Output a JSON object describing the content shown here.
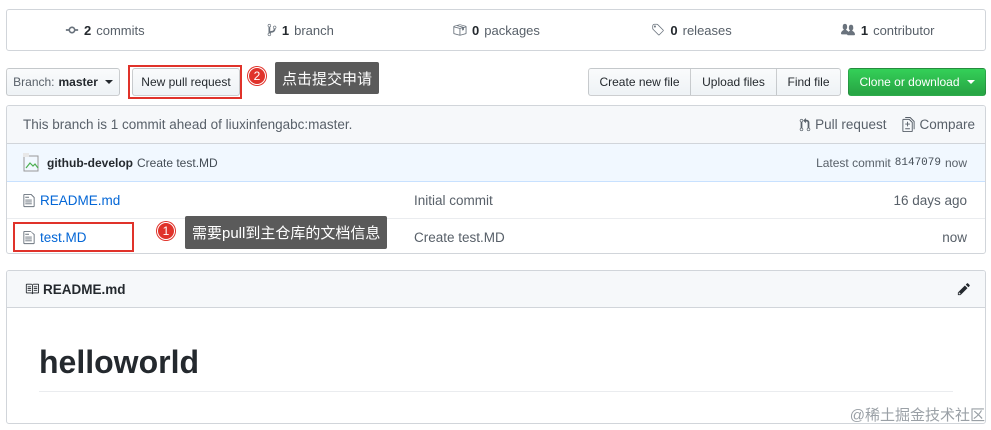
{
  "stats": {
    "commits": {
      "count": "2",
      "label": "commits",
      "icon": "commits-icon"
    },
    "branches": {
      "count": "1",
      "label": "branch",
      "icon": "branch-icon"
    },
    "packages": {
      "count": "0",
      "label": "packages",
      "icon": "package-icon"
    },
    "releases": {
      "count": "0",
      "label": "releases",
      "icon": "tag-icon"
    },
    "contributors": {
      "count": "1",
      "label": "contributor",
      "icon": "people-icon"
    }
  },
  "toolbar": {
    "branch_prefix": "Branch:",
    "branch_name": "master",
    "new_pull_request": "New pull request",
    "create_new_file": "Create new file",
    "upload_files": "Upload files",
    "find_file": "Find file",
    "clone_or_download": "Clone or download"
  },
  "annotations": {
    "a2_number": "2",
    "a2_text": "点击提交申请",
    "a1_number": "1",
    "a1_text": "需要pull到主仓库的文档信息",
    "box_color": "#e0322a"
  },
  "branch_info": {
    "ahead_text": "This branch is 1 commit ahead of liuxinfengabc:master.",
    "pull_request": "Pull request",
    "compare": "Compare"
  },
  "latest_commit": {
    "author": "github-develop",
    "message": "Create test.MD",
    "label": "Latest commit",
    "sha": "8147079",
    "time": "now"
  },
  "files": [
    {
      "name": "README.md",
      "message": "Initial commit",
      "age": "16 days ago"
    },
    {
      "name": "test.MD",
      "message": "Create test.MD",
      "age": "now"
    }
  ],
  "readme": {
    "filename": "README.md",
    "heading": "helloworld"
  },
  "watermark": "@稀土掘金技术社区",
  "colors": {
    "link": "#0366d6",
    "green": "#28a745",
    "annotation_red": "#e0322a"
  }
}
